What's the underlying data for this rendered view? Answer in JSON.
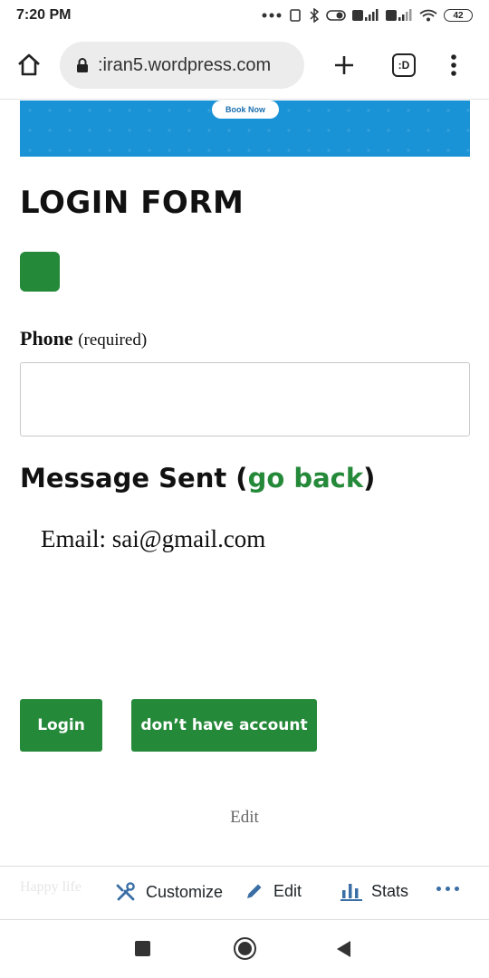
{
  "statusbar": {
    "time": "7:20 PM",
    "battery": "42"
  },
  "browser": {
    "url": ":iran5.wordpress.com",
    "tabs_label": ":D"
  },
  "banner": {
    "book_now": "Book Now"
  },
  "form": {
    "title": "LOGIN FORM",
    "phone_label": "Phone",
    "phone_required": "(required)",
    "phone_value": "",
    "message_sent": "Message Sent (",
    "go_back": "go back",
    "message_close": ")",
    "email_line": "Email: sai@gmail.com",
    "login_button": "Login",
    "no_account_button": "don’t have account",
    "edit_link": "Edit"
  },
  "adminbar": {
    "ghost_text": "Happy life",
    "customize": "Customize",
    "edit": "Edit",
    "stats": "Stats"
  },
  "colors": {
    "accent_green": "#25893a",
    "banner_blue": "#1a93d6"
  },
  "icons": [
    "home-icon",
    "lock-icon",
    "plus-icon",
    "tabs-icon",
    "overflow-menu-icon",
    "wrench-icon",
    "pencil-icon",
    "bar-chart-icon",
    "more-icon"
  ]
}
